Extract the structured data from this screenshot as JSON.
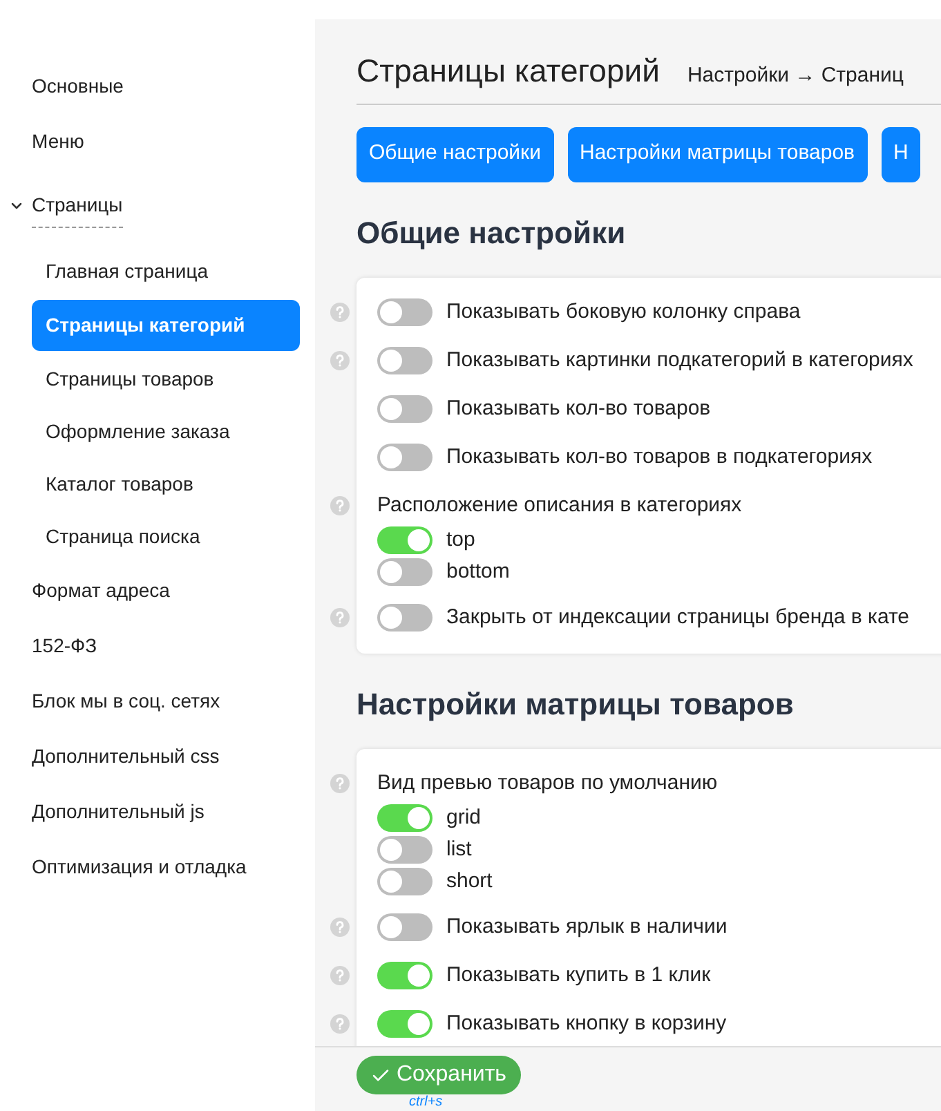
{
  "sidebar": {
    "items": [
      {
        "label": "Основные",
        "selected": false
      },
      {
        "label": "Меню",
        "selected": false
      },
      {
        "label": "Страницы",
        "selected": false,
        "expanded": true,
        "children": [
          {
            "label": "Главная страница",
            "selected": false
          },
          {
            "label": "Страницы категорий",
            "selected": true
          },
          {
            "label": "Страницы товаров",
            "selected": false
          },
          {
            "label": "Оформление заказа",
            "selected": false
          },
          {
            "label": "Каталог товаров",
            "selected": false
          },
          {
            "label": "Страница поиска",
            "selected": false
          }
        ]
      },
      {
        "label": "Формат адреса",
        "selected": false
      },
      {
        "label": "152-ФЗ",
        "selected": false
      },
      {
        "label": "Блок мы в соц. сетях",
        "selected": false
      },
      {
        "label": "Дополнительный css",
        "selected": false
      },
      {
        "label": "Дополнительный js",
        "selected": false
      },
      {
        "label": "Оптимизация и отладка",
        "selected": false
      }
    ]
  },
  "page": {
    "title": "Страницы категорий",
    "breadcrumb": "Настройки → Страниц"
  },
  "tabs": [
    {
      "label": "Общие настройки"
    },
    {
      "label": "Настройки матрицы товаров"
    },
    {
      "label": "Н"
    }
  ],
  "sections": [
    {
      "title": "Общие настройки",
      "settings": [
        {
          "kind": "toggle",
          "help": true,
          "label": "Показывать боковую колонку справа",
          "on": false
        },
        {
          "kind": "toggle",
          "help": true,
          "label": "Показывать картинки подкатегорий в категориях",
          "on": false
        },
        {
          "kind": "toggle",
          "help": false,
          "label": "Показывать кол-во товаров",
          "on": false
        },
        {
          "kind": "toggle",
          "help": false,
          "label": "Показывать кол-во товаров в подкатегориях",
          "on": false
        },
        {
          "kind": "choice",
          "help": true,
          "label": "Расположение описания в категориях",
          "options": [
            {
              "label": "top",
              "on": true
            },
            {
              "label": "bottom",
              "on": false
            }
          ]
        },
        {
          "kind": "toggle",
          "help": true,
          "label": "Закрыть от индексации страницы бренда в кате",
          "on": false
        }
      ]
    },
    {
      "title": "Настройки матрицы товаров",
      "settings": [
        {
          "kind": "choice",
          "help": true,
          "label": "Вид превью товаров по умолчанию",
          "options": [
            {
              "label": "grid",
              "on": true
            },
            {
              "label": "list",
              "on": false
            },
            {
              "label": "short",
              "on": false
            }
          ]
        },
        {
          "kind": "toggle",
          "help": true,
          "label": "Показывать ярлык в наличии",
          "on": false
        },
        {
          "kind": "toggle",
          "help": true,
          "label": "Показывать купить в 1 клик",
          "on": true
        },
        {
          "kind": "toggle",
          "help": true,
          "label": "Показывать кнопку в корзину",
          "on": true
        }
      ]
    }
  ],
  "footer": {
    "save": "Сохранить",
    "shortcut": "ctrl+s"
  }
}
